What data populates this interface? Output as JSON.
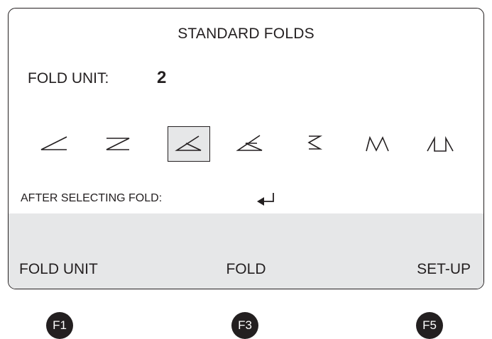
{
  "screen": {
    "title": "STANDARD FOLDS",
    "fold_unit": {
      "label": "FOLD UNIT:",
      "value": "2"
    },
    "folds": [
      {
        "icon": "single-fold-icon",
        "selected": false
      },
      {
        "icon": "z-fold-icon",
        "selected": false
      },
      {
        "icon": "letter-fold-icon",
        "selected": true
      },
      {
        "icon": "double-parallel-fold-icon",
        "selected": false
      },
      {
        "icon": "accordion-fold-icon",
        "selected": false
      },
      {
        "icon": "double-accordion-fold-icon",
        "selected": false
      },
      {
        "icon": "gate-fold-icon",
        "selected": false
      }
    ],
    "after_selecting": "AFTER SELECTING FOLD:",
    "enter_icon": "enter-key-icon",
    "softkeys": {
      "left": "FOLD UNIT",
      "middle": "FOLD",
      "right": "SET-UP"
    }
  },
  "function_keys": {
    "f1": "F1",
    "f3": "F3",
    "f5": "F5"
  },
  "colors": {
    "ink": "#231f20",
    "panel_gray": "#e6e7e8",
    "background": "#ffffff"
  }
}
